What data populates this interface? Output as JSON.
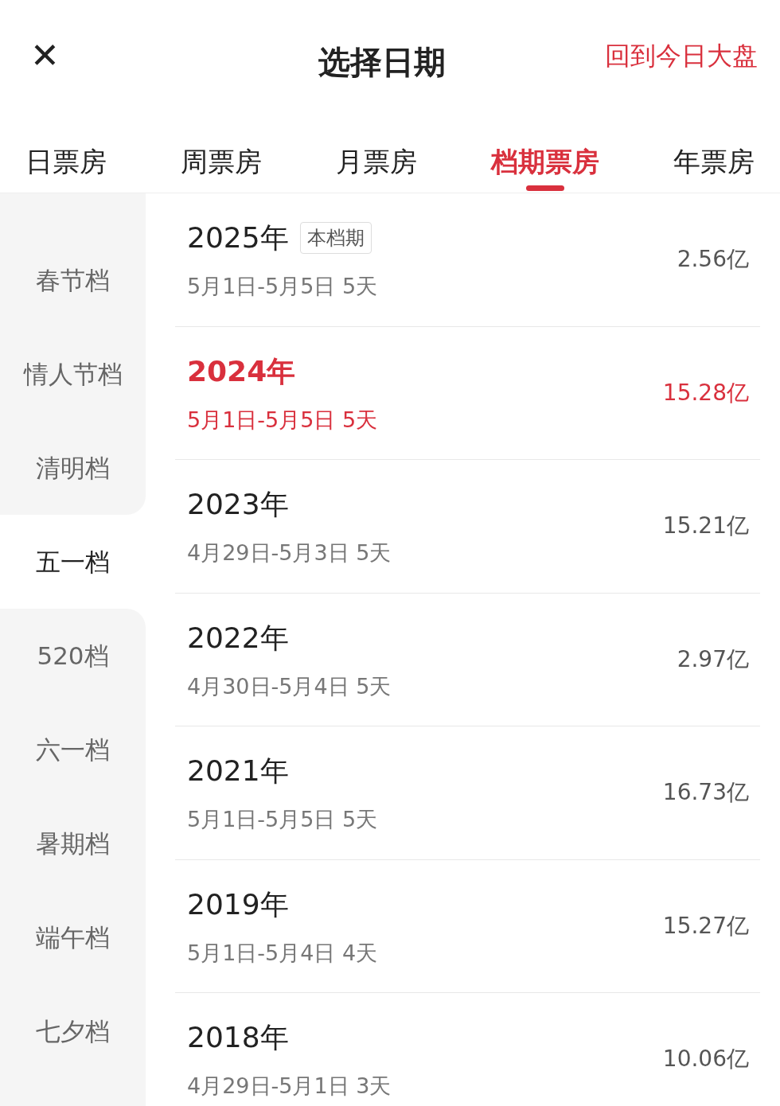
{
  "header": {
    "close": "✕",
    "title": "选择日期",
    "link": "回到今日大盘"
  },
  "tabs": [
    {
      "label": "日票房",
      "selected": false
    },
    {
      "label": "周票房",
      "selected": false
    },
    {
      "label": "月票房",
      "selected": false
    },
    {
      "label": "档期票房",
      "selected": true
    },
    {
      "label": "年票房",
      "selected": false
    }
  ],
  "sidebar": [
    {
      "label": "春节档",
      "selected": false
    },
    {
      "label": "情人节档",
      "selected": false
    },
    {
      "label": "清明档",
      "selected": false
    },
    {
      "label": "五一档",
      "selected": true
    },
    {
      "label": "520档",
      "selected": false
    },
    {
      "label": "六一档",
      "selected": false
    },
    {
      "label": "暑期档",
      "selected": false
    },
    {
      "label": "端午档",
      "selected": false
    },
    {
      "label": "七夕档",
      "selected": false
    }
  ],
  "rows": [
    {
      "year": "2025年",
      "badge": "本档期",
      "dates": "5月1日-5月5日 5天",
      "amount": "2.56亿",
      "selected": false
    },
    {
      "year": "2024年",
      "dates": "5月1日-5月5日 5天",
      "amount": "15.28亿",
      "selected": true
    },
    {
      "year": "2023年",
      "dates": "4月29日-5月3日 5天",
      "amount": "15.21亿",
      "selected": false
    },
    {
      "year": "2022年",
      "dates": "4月30日-5月4日 5天",
      "amount": "2.97亿",
      "selected": false
    },
    {
      "year": "2021年",
      "dates": "5月1日-5月5日 5天",
      "amount": "16.73亿",
      "selected": false
    },
    {
      "year": "2019年",
      "dates": "5月1日-5月4日 4天",
      "amount": "15.27亿",
      "selected": false
    },
    {
      "year": "2018年",
      "dates": "4月29日-5月1日 3天",
      "amount": "10.06亿",
      "selected": false
    }
  ]
}
